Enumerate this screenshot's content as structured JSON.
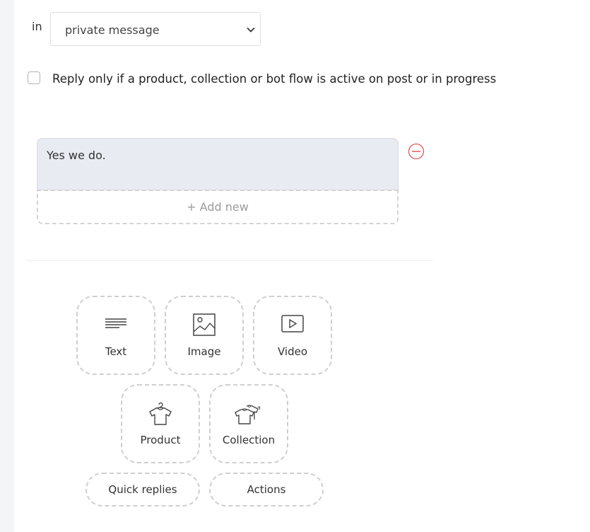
{
  "trigger": {
    "in_label": "in",
    "channel_select": {
      "value": "private message"
    }
  },
  "condition": {
    "checkbox_checked": false,
    "label": "Reply only if a product, collection or bot flow is active on post or in progress"
  },
  "message": {
    "text": "Yes we do.",
    "add_new_label": "+ Add new"
  },
  "content_types": [
    {
      "label": "Text",
      "icon": "text-lines-icon"
    },
    {
      "label": "Image",
      "icon": "image-icon"
    },
    {
      "label": "Video",
      "icon": "video-play-icon"
    },
    {
      "label": "Product",
      "icon": "shirt-hanger-icon"
    },
    {
      "label": "Collection",
      "icon": "shirts-stack-icon"
    }
  ],
  "extra_actions": [
    {
      "label": "Quick replies"
    },
    {
      "label": "Actions"
    }
  ],
  "colors": {
    "remove_red": "#e05a5a",
    "message_bg": "#e8ebf1",
    "dashed_border": "#cfcfcf"
  }
}
